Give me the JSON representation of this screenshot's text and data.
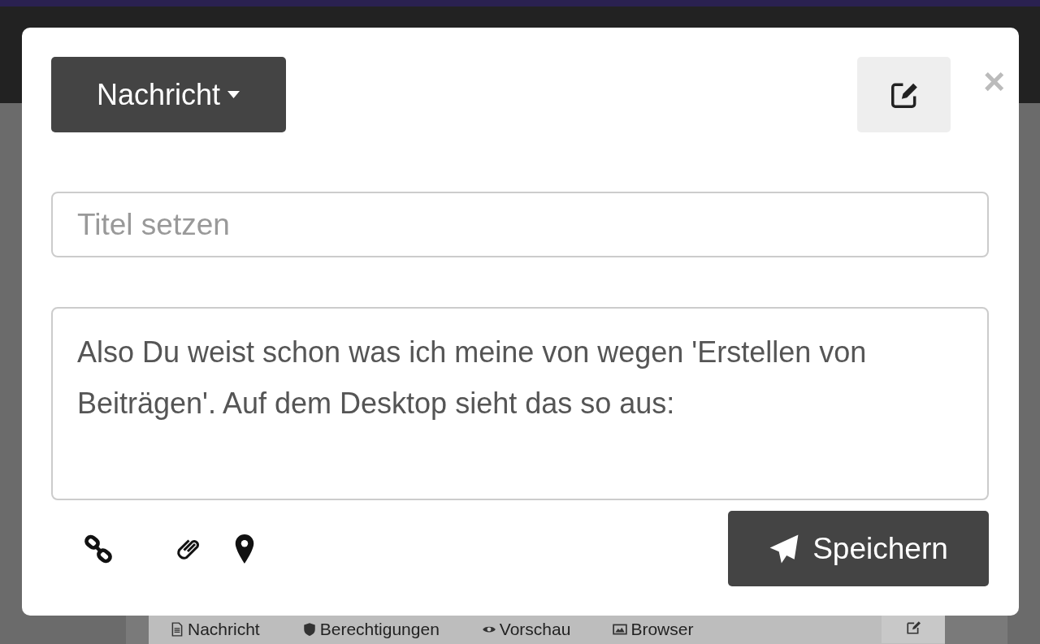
{
  "dialog": {
    "type_menu": {
      "label": "Nachricht"
    },
    "close": {
      "label": "×"
    },
    "title_field": {
      "placeholder": "Titel setzen"
    },
    "body_field": {
      "value": "Also Du weist schon was ich meine von wegen 'Erstellen von Beiträgen'. Auf dem Desktop sieht das so aus:"
    },
    "save_button": {
      "label": "Speichern"
    }
  },
  "background_tabs": [
    {
      "label": "Nachricht"
    },
    {
      "label": "Berechtigungen"
    },
    {
      "label": "Vorschau"
    },
    {
      "label": "Browser"
    }
  ]
}
